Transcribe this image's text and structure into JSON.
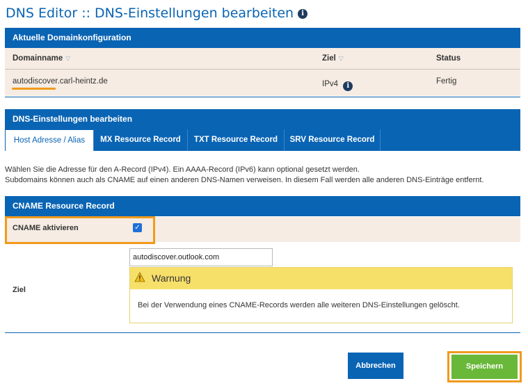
{
  "title": "DNS Editor :: DNS-Einstellungen bearbeiten",
  "domain_config": {
    "header": "Aktuelle Domainkonfiguration",
    "columns": [
      "Domainname",
      "Ziel",
      "Status"
    ],
    "row": {
      "domain": "autodiscover.carl-heintz.de",
      "target": "IPv4",
      "status": "Fertig"
    }
  },
  "dns_settings": {
    "header": "DNS-Einstellungen bearbeiten",
    "tabs": [
      "Host Adresse / Alias",
      "MX Resource Record",
      "TXT Resource Record",
      "SRV Resource Record"
    ],
    "active_tab": 0
  },
  "intro": {
    "line1": "Wählen Sie die Adresse für den A-Record (IPv4). Ein AAAA-Record (IPv6) kann optional gesetzt werden.",
    "line2": "Subdomains können auch als CNAME auf einen anderen DNS-Namen verweisen. In diesem Fall werden alle anderen DNS-Einträge entfernt."
  },
  "cname": {
    "header": "CNAME Resource Record",
    "activate_label": "CNAME aktivieren",
    "activated": true,
    "target_label": "Ziel",
    "target_value": "autodiscover.outlook.com",
    "warning_title": "Warnung",
    "warning_text": "Bei der Verwendung eines CNAME-Records werden alle weiteren DNS-Einstellungen gelöscht."
  },
  "buttons": {
    "cancel": "Abbrechen",
    "save": "Speichern"
  },
  "colors": {
    "primary": "#0a64b4",
    "accent_orange": "#f19a1b",
    "save_green": "#6ab83a",
    "warning_yellow": "#f7e06a",
    "row_beige": "#f6ece3"
  },
  "icons": {
    "info": "info-icon",
    "sort": "sort-icon",
    "warning": "warning-icon",
    "check": "check-icon"
  }
}
